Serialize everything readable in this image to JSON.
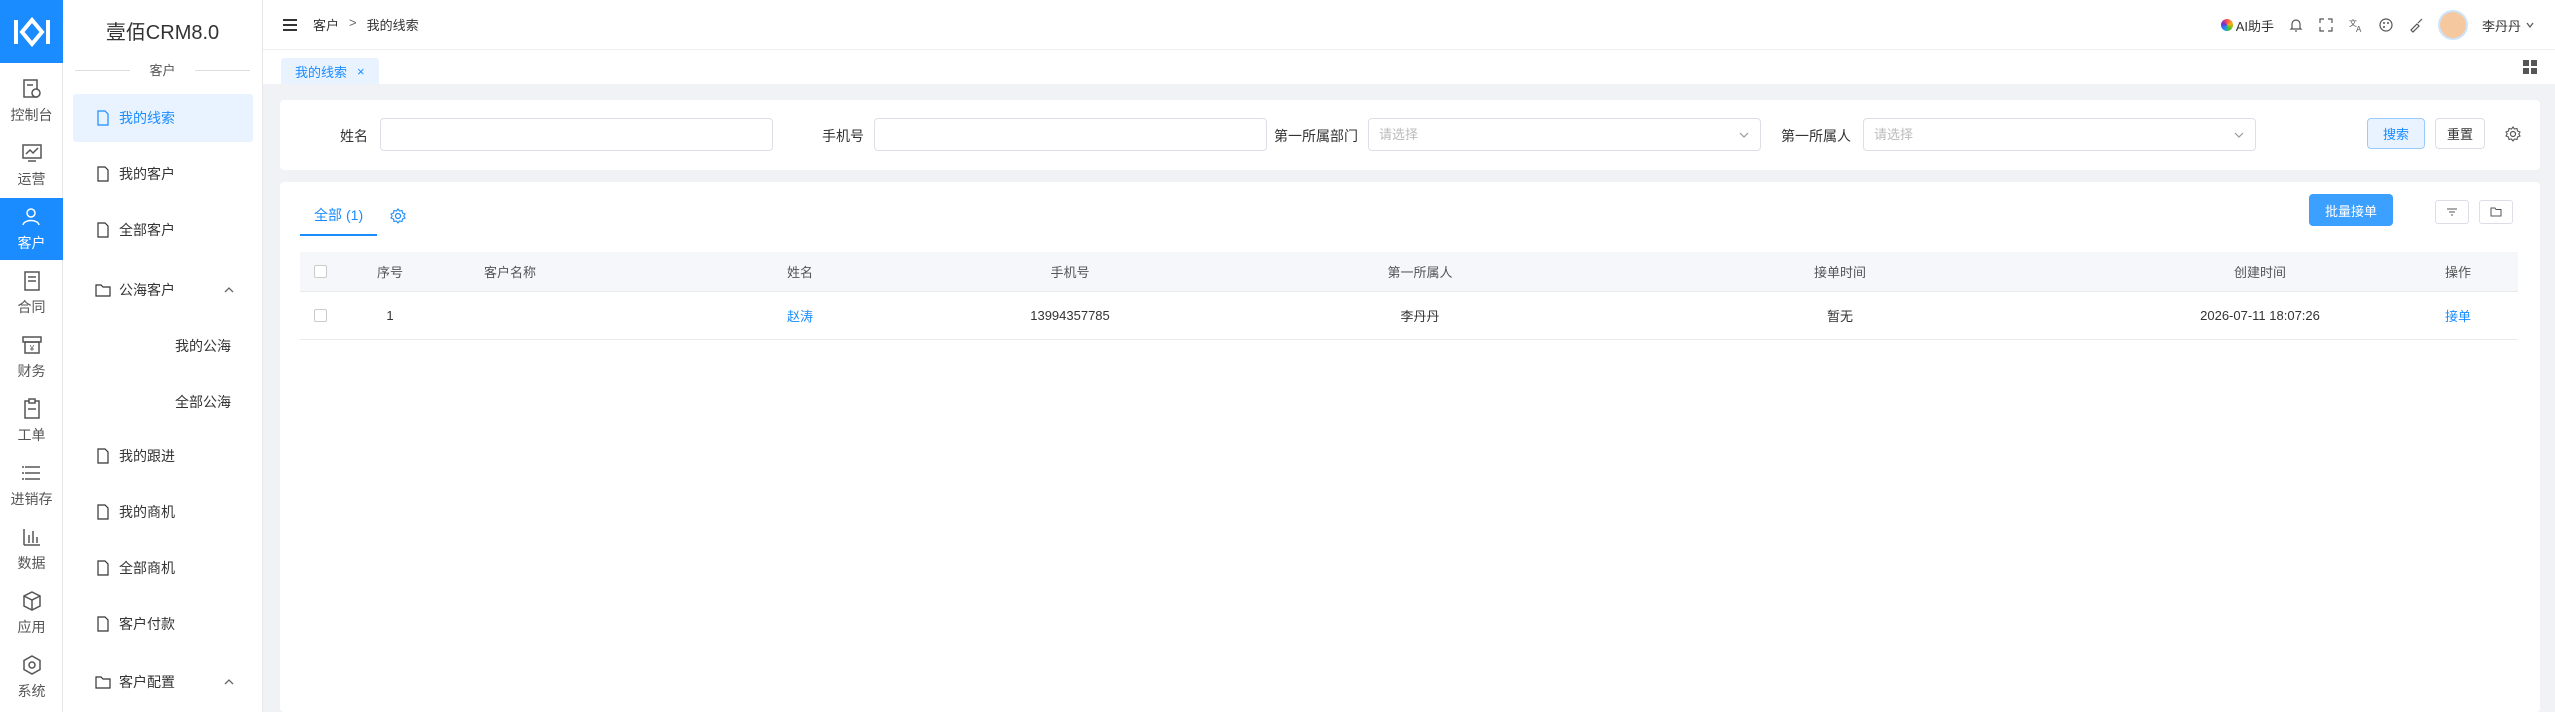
{
  "app": {
    "name": "壹佰CRM8.0",
    "section": "客户"
  },
  "rail": [
    {
      "label": "控制台",
      "icon": "dashboard-icon"
    },
    {
      "label": "运营",
      "icon": "operations-icon"
    },
    {
      "label": "客户",
      "icon": "customer-icon",
      "active": true
    },
    {
      "label": "合同",
      "icon": "contract-icon"
    },
    {
      "label": "财务",
      "icon": "finance-icon"
    },
    {
      "label": "工单",
      "icon": "ticket-icon"
    },
    {
      "label": "进销存",
      "icon": "inventory-icon"
    },
    {
      "label": "数据",
      "icon": "data-icon"
    },
    {
      "label": "应用",
      "icon": "apps-icon"
    },
    {
      "label": "系统",
      "icon": "system-icon"
    }
  ],
  "menu": {
    "my_leads": "我的线索",
    "my_customers": "我的客户",
    "all_customers": "全部客户",
    "public_pool": "公海客户",
    "my_pool": "我的公海",
    "all_pool": "全部公海",
    "my_followups": "我的跟进",
    "my_opportunities": "我的商机",
    "all_opportunities": "全部商机",
    "customer_payments": "客户付款",
    "customer_config": "客户配置"
  },
  "breadcrumb": {
    "root": "客户",
    "sep": ">",
    "current": "我的线索"
  },
  "topbar": {
    "ai": "AI助手",
    "user": "李丹丹"
  },
  "open_tab": {
    "label": "我的线索",
    "close": "×"
  },
  "search": {
    "name_label": "姓名",
    "phone_label": "手机号",
    "dept_label": "第一所属部门",
    "dept_placeholder": "请选择",
    "owner_label": "第一所属人",
    "owner_placeholder": "请选择",
    "search_btn": "搜索",
    "reset_btn": "重置"
  },
  "list": {
    "tab_label": "全部",
    "tab_count": "(1)",
    "bulk_btn": "批量接单",
    "columns": [
      "序号",
      "客户名称",
      "姓名",
      "手机号",
      "第一所属人",
      "接单时间",
      "创建时间",
      "操作"
    ],
    "rows": [
      {
        "index": "1",
        "customer": "",
        "name": "赵涛",
        "phone": "13994357785",
        "owner": "李丹丹",
        "accept_time": "暂无",
        "created": "2026-07-11 18:07:26",
        "action": "接单"
      }
    ]
  },
  "colors": {
    "primary": "#1a8cff",
    "active_bg": "#e8f3ff"
  }
}
